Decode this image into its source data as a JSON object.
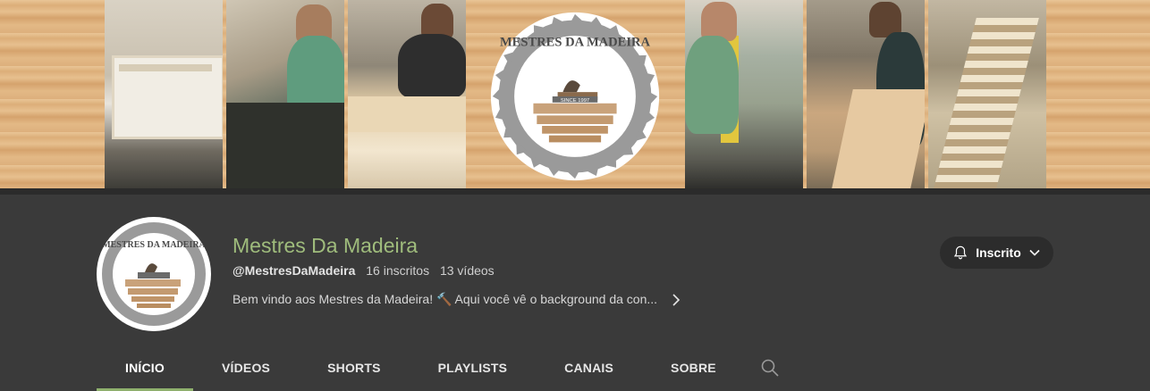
{
  "channel": {
    "name": "Mestres Da Madeira",
    "handle": "@MestresDaMadeira",
    "subscribers": "16 inscritos",
    "videos": "13 vídeos",
    "description": "Bem vindo aos Mestres da Madeira! 🔨 Aqui você vê o background da con..."
  },
  "logo": {
    "text": "MESTRES DA MADEIRA",
    "since": "SINCE 1997"
  },
  "subscribe_button": {
    "label": "Inscrito",
    "icon": "bell-icon",
    "dropdown_icon": "chevron-down-icon"
  },
  "tabs": [
    {
      "label": "INÍCIO",
      "active": true
    },
    {
      "label": "VÍDEOS",
      "active": false
    },
    {
      "label": "SHORTS",
      "active": false
    },
    {
      "label": "PLAYLISTS",
      "active": false
    },
    {
      "label": "CANAIS",
      "active": false
    },
    {
      "label": "SOBRE",
      "active": false
    }
  ],
  "colors": {
    "background": "#3a3a3a",
    "channel_name": "#9fbc7c",
    "tab_underline": "#8fb06d"
  }
}
